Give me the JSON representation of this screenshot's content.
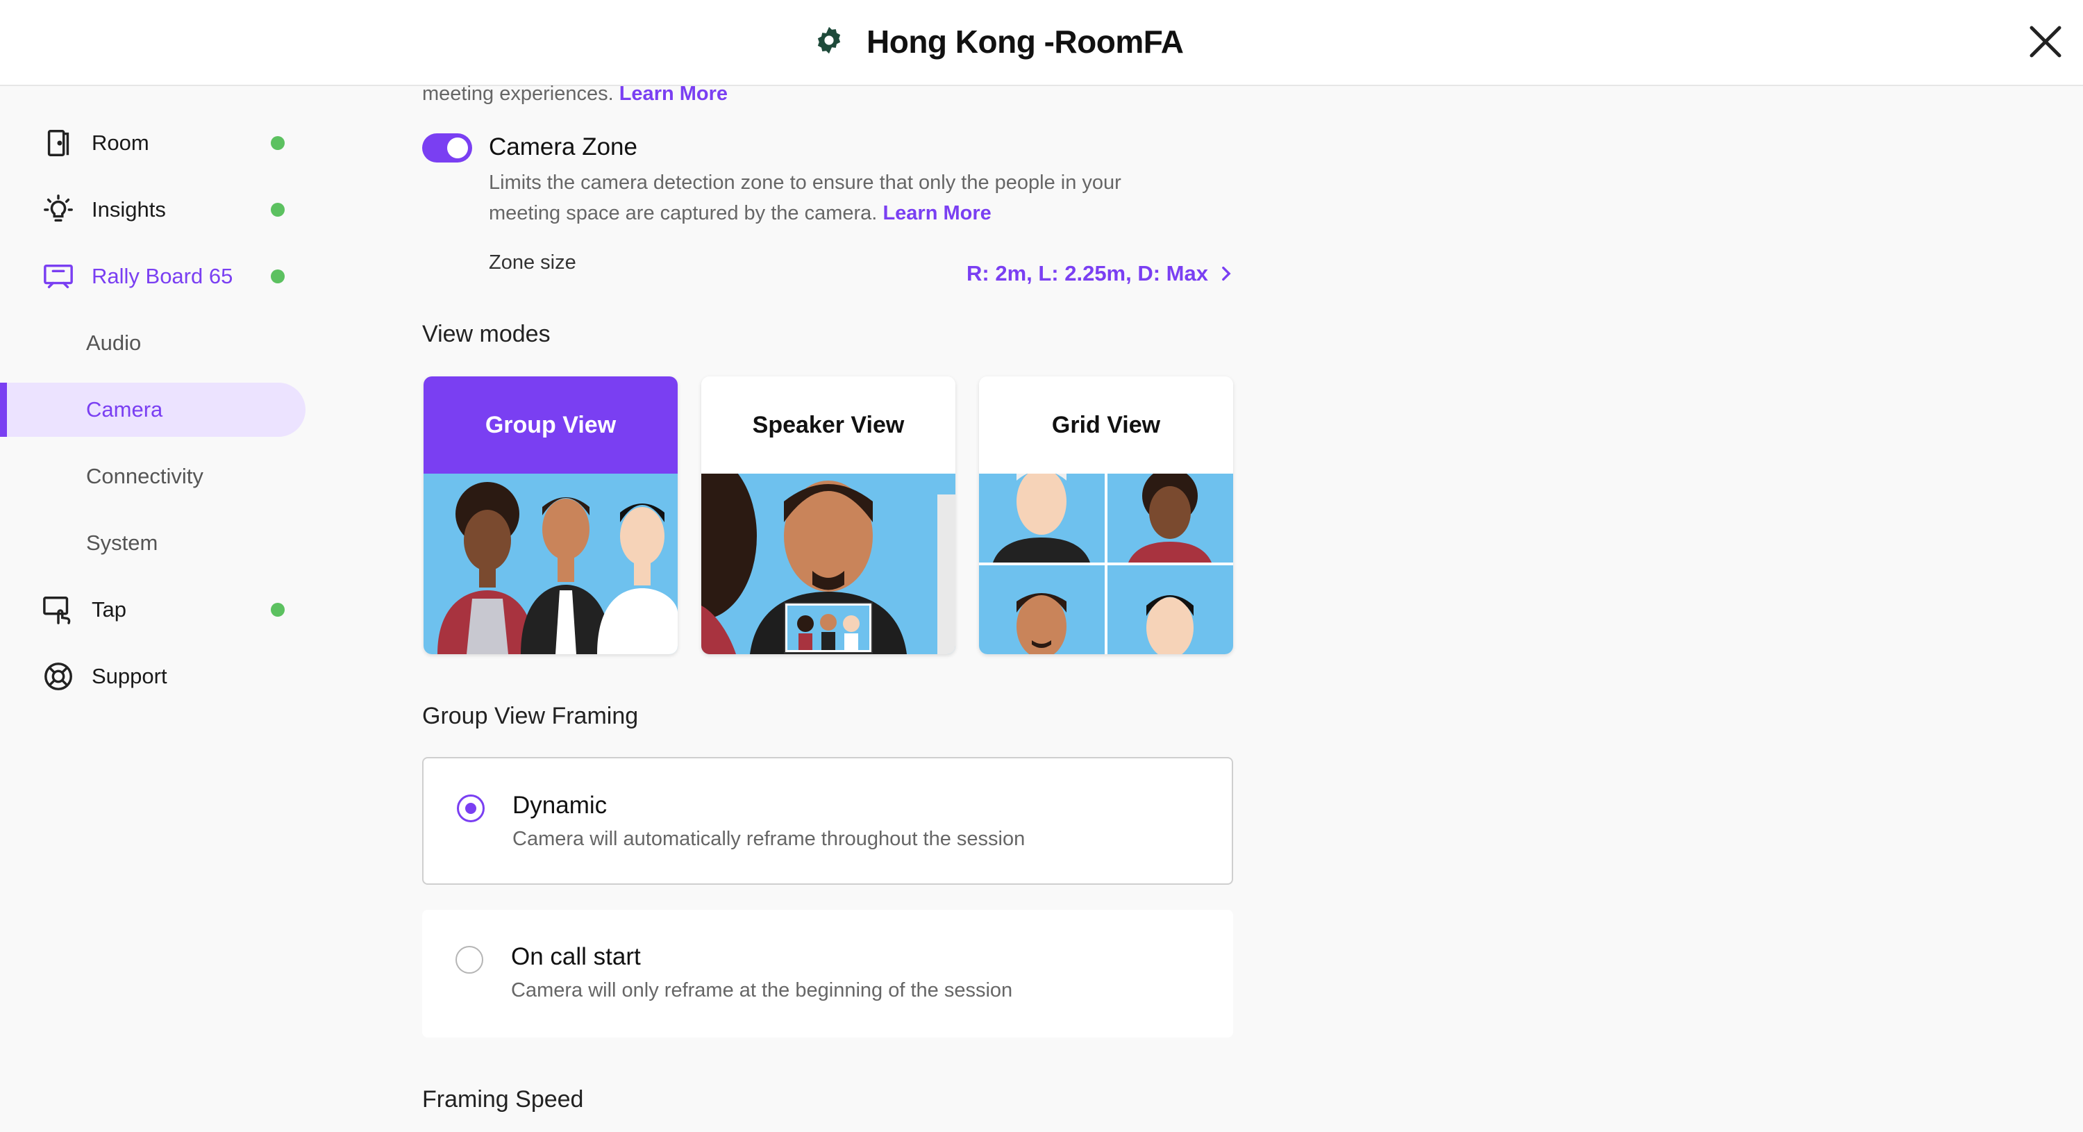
{
  "header": {
    "title": "Hong Kong -RoomFA",
    "close_icon": "close-icon",
    "settings_icon": "gear-icon"
  },
  "sidebar": {
    "items": [
      {
        "label": "Room",
        "icon": "room-door-icon",
        "status": "online"
      },
      {
        "label": "Insights",
        "icon": "lightbulb-icon",
        "status": "online"
      },
      {
        "label": "Rally Board 65",
        "icon": "display-board-icon",
        "status": "online"
      },
      {
        "label": "Tap",
        "icon": "touch-tap-icon",
        "status": "online"
      },
      {
        "label": "Support",
        "icon": "lifebuoy-icon"
      }
    ],
    "subitems": [
      "Audio",
      "Camera",
      "Connectivity",
      "System"
    ],
    "selected_subitem": "Camera"
  },
  "top_note": {
    "text": "meeting experiences.",
    "link": "Learn More"
  },
  "camera_zone": {
    "title": "Camera Zone",
    "enabled": true,
    "desc_line1": "Limits the camera detection zone to ensure that only the people in your",
    "desc_line2": "meeting space are captured by the camera.",
    "link": "Learn More",
    "zone_label": "Zone size",
    "zone_value": "R: 2m, L: 2.25m, D: Max"
  },
  "view_modes": {
    "title": "View modes",
    "cards": [
      {
        "label": "Group View",
        "selected": true
      },
      {
        "label": "Speaker View",
        "selected": false
      },
      {
        "label": "Grid View",
        "selected": false
      }
    ]
  },
  "framing": {
    "title": "Group View Framing",
    "options": [
      {
        "title": "Dynamic",
        "desc": "Camera will automatically reframe throughout the session",
        "selected": true
      },
      {
        "title": "On call start",
        "desc": "Camera will only reframe at the beginning of the session",
        "selected": false
      }
    ]
  },
  "framing_speed": {
    "title": "Framing Speed"
  },
  "colors": {
    "accent": "#7a3ff2",
    "status_online": "#5cc160",
    "selected_bg": "#ece3ff"
  }
}
